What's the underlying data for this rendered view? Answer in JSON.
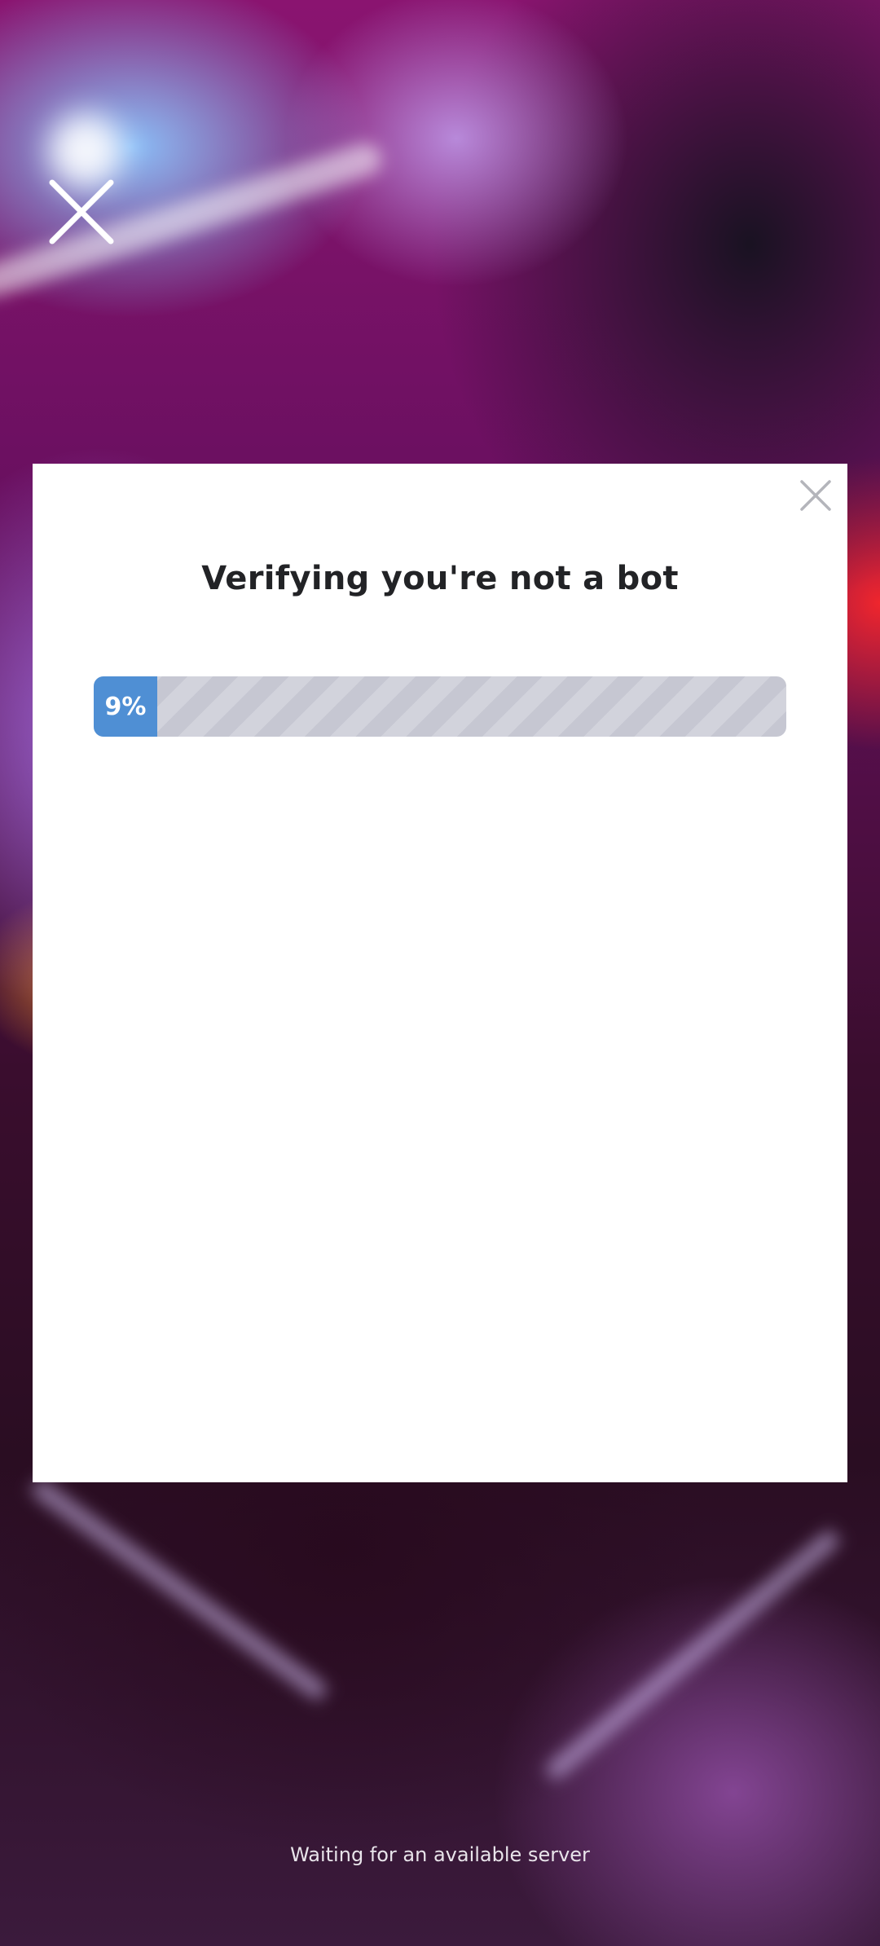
{
  "background": {
    "description_icon": "game-background-image"
  },
  "top_close": {
    "icon": "close-icon"
  },
  "modal": {
    "close_icon": "close-icon",
    "title": "Verifying you're not a bot",
    "progress": {
      "percent": 9,
      "label": "9%",
      "fill_color": "#4f8fd4",
      "track_color": "#c6c7d2"
    }
  },
  "status": {
    "text": "Waiting for an available server"
  }
}
